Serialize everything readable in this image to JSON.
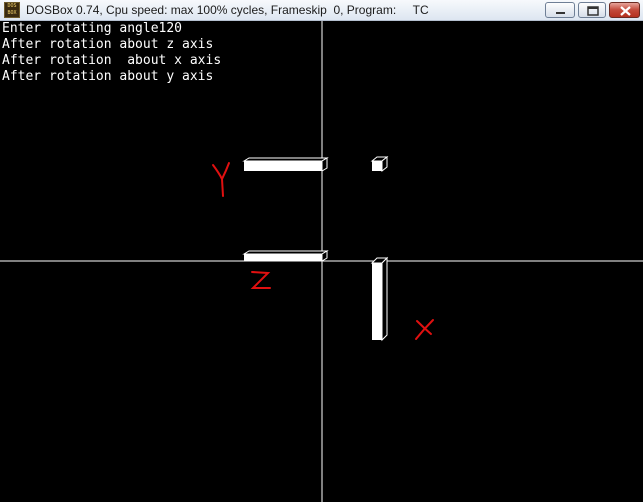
{
  "window": {
    "title": "DOSBox 0.74, Cpu speed: max 100% cycles, Frameskip  0, Program:     TC",
    "icon": "dosbox-icon",
    "icon_text": "DOS BOX",
    "buttons": [
      "minimize-icon",
      "maximize-icon",
      "close-icon"
    ]
  },
  "console": {
    "lines": [
      "Enter rotating angle120",
      "After rotation about z axis",
      "After rotation  about x axis",
      "After rotation about y axis"
    ]
  },
  "annotations": {
    "y_label": "Y",
    "z_label": "Z",
    "x_label": "X",
    "color": "#e01010"
  },
  "colors": {
    "background": "#000000",
    "foreground": "#ffffff"
  }
}
